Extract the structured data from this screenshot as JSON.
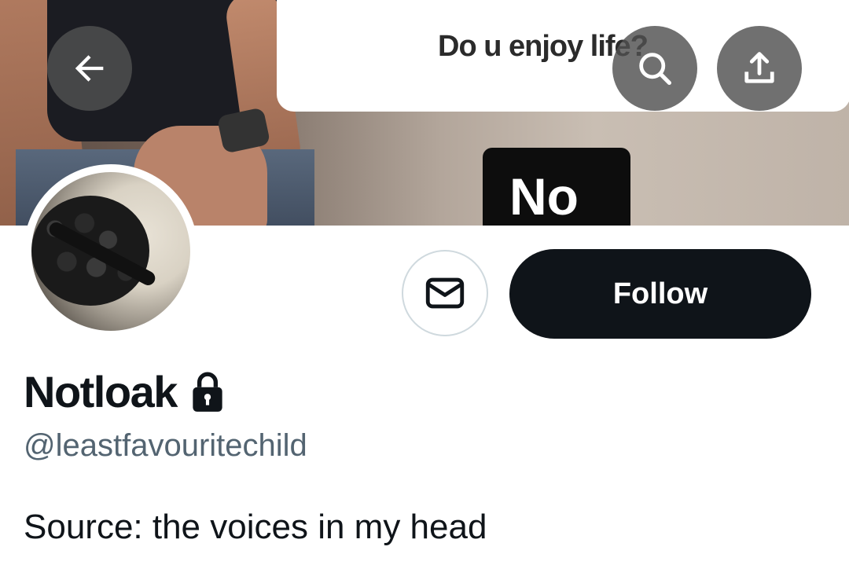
{
  "banner": {
    "question_text": "Do u enjoy life?",
    "answer_text": "No"
  },
  "nav": {
    "back_icon": "back-arrow-icon",
    "search_icon": "search-icon",
    "share_icon": "share-icon"
  },
  "actions": {
    "message_icon": "mail-icon",
    "follow_label": "Follow"
  },
  "profile": {
    "display_name": "Notloak",
    "protected_icon": "lock-icon",
    "handle": "@leastfavouritechild",
    "bio": "Source: the voices in my head"
  },
  "colors": {
    "primary_text": "#0f1419",
    "secondary_text": "#536471",
    "follow_button_bg": "#0f1419",
    "border": "#cfd9de"
  }
}
